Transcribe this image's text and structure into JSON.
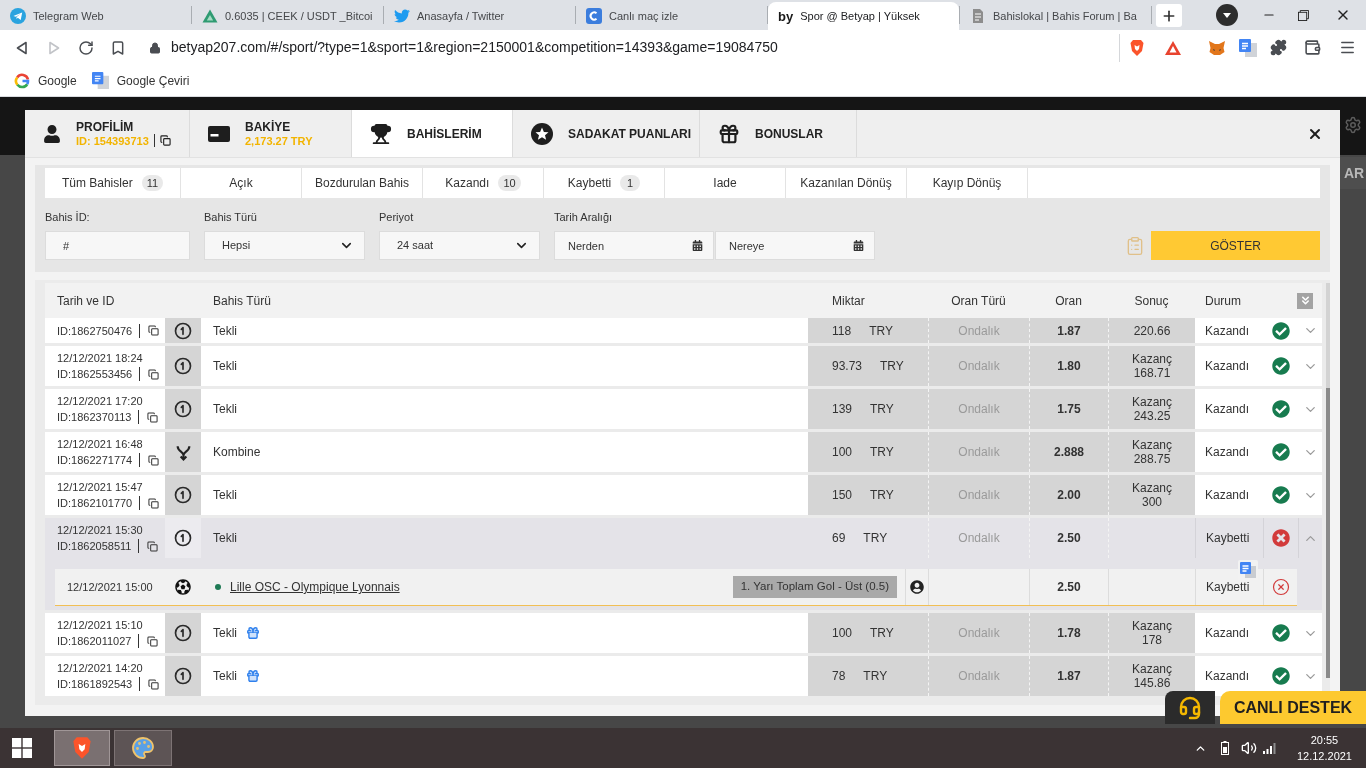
{
  "browser": {
    "tabs": [
      {
        "title": "Telegram Web",
        "kind": "telegram",
        "selected": false
      },
      {
        "title": "0.6035 | CEEK / USDT _Bitcoi",
        "kind": "ceek",
        "selected": false
      },
      {
        "title": "Anasayfa / Twitter",
        "kind": "twitter",
        "selected": false
      },
      {
        "title": "Canlı maç izle",
        "kind": "stream",
        "selected": false
      },
      {
        "title": "Spor @ Betyap | Yüksek",
        "kind": "betyap",
        "icon_text": "by",
        "selected": true
      },
      {
        "title": "Bahislokal | Bahis Forum | Ba",
        "kind": "forum",
        "selected": false
      }
    ],
    "forward_disabled": true,
    "url": "betyap207.com/#/sport/?type=1&sport=1&region=2150001&competition=14393&game=19084750",
    "bookmarks": [
      {
        "label": "Google",
        "kind": "google"
      },
      {
        "label": "Google Çeviri",
        "kind": "translate"
      }
    ]
  },
  "site_background": {
    "button_text": "AR"
  },
  "modal": {
    "tabs": [
      {
        "kind": "profile",
        "title": "PROFİLİM",
        "subtitle": "ID: 154393713",
        "selected": false
      },
      {
        "kind": "balance",
        "title": "BAKİYE",
        "subtitle": "2,173.27 TRY",
        "selected": false
      },
      {
        "kind": "bets",
        "title": "BAHİSLERİM",
        "selected": true
      },
      {
        "kind": "loyalty",
        "title": "SADAKAT PUANLARI",
        "selected": false
      },
      {
        "kind": "bonus",
        "title": "BONUSLAR",
        "selected": false
      }
    ],
    "filter_tabs": [
      {
        "label": "Tüm Bahisler",
        "count": "11"
      },
      {
        "label": "Açık"
      },
      {
        "label": "Bozdurulan Bahis"
      },
      {
        "label": "Kazandı",
        "count": "10"
      },
      {
        "label": "Kaybetti",
        "count": "1"
      },
      {
        "label": "Iade"
      },
      {
        "label": "Kazanılan Dönüş"
      },
      {
        "label": "Kayıp Dönüş"
      }
    ],
    "filters": [
      {
        "kind": "input",
        "label": "Bahis İD:",
        "placeholder": "#"
      },
      {
        "kind": "select",
        "label": "Bahis Türü",
        "value": "Hepsi"
      },
      {
        "kind": "select",
        "label": "Periyot",
        "value": "24 saat"
      },
      {
        "kind": "date_range",
        "label": "Tarih Aralığı",
        "from_placeholder": "Nerden",
        "to_placeholder": "Nereye"
      }
    ],
    "show_button": "GÖSTER",
    "table": {
      "columns": [
        "Tarih ve ID",
        "Bahis Türü",
        "Miktar",
        "Oran Türü",
        "Oran",
        "Sonuç",
        "Durum"
      ],
      "rows": [
        {
          "id": "ID:1862750476",
          "kind": "single",
          "type": "Tekli",
          "bonus": false,
          "amount": "118",
          "currency": "TRY",
          "odds_type": "Ondalık",
          "odds": "1.87",
          "result": {
            "value": "220.66"
          },
          "status": "Kazandı",
          "won": true,
          "expanded": false
        },
        {
          "date": "12/12/2021 18:24",
          "id": "ID:1862553456",
          "kind": "single",
          "type": "Tekli",
          "bonus": false,
          "amount": "93.73",
          "currency": "TRY",
          "odds_type": "Ondalık",
          "odds": "1.80",
          "result": {
            "label": "Kazanç",
            "value": "168.71"
          },
          "status": "Kazandı",
          "won": true,
          "expanded": false
        },
        {
          "date": "12/12/2021 17:20",
          "id": "ID:1862370113",
          "kind": "single",
          "type": "Tekli",
          "bonus": false,
          "amount": "139",
          "currency": "TRY",
          "odds_type": "Ondalık",
          "odds": "1.75",
          "result": {
            "label": "Kazanç",
            "value": "243.25"
          },
          "status": "Kazandı",
          "won": true,
          "expanded": false
        },
        {
          "date": "12/12/2021 16:48",
          "id": "ID:1862271774",
          "kind": "combo",
          "type": "Kombine",
          "bonus": false,
          "amount": "100",
          "currency": "TRY",
          "odds_type": "Ondalık",
          "odds": "2.888",
          "result": {
            "label": "Kazanç",
            "value": "288.75"
          },
          "status": "Kazandı",
          "won": true,
          "expanded": false
        },
        {
          "date": "12/12/2021 15:47",
          "id": "ID:1862101770",
          "kind": "single",
          "type": "Tekli",
          "bonus": false,
          "amount": "150",
          "currency": "TRY",
          "odds_type": "Ondalık",
          "odds": "2.00",
          "result": {
            "label": "Kazanç",
            "value": "300"
          },
          "status": "Kazandı",
          "won": true,
          "expanded": false
        },
        {
          "date": "12/12/2021 15:30",
          "id": "ID:1862058511",
          "kind": "single",
          "type": "Tekli",
          "bonus": false,
          "amount": "69",
          "currency": "TRY",
          "odds_type": "Ondalık",
          "odds": "2.50",
          "status": "Kaybetti",
          "won": false,
          "expanded": true,
          "selections": [
            {
              "date": "12/12/2021 15:00",
              "match": "Lille OSC - Olympique Lyonnais",
              "market": "1. Yarı Toplam Gol - Üst (0.5)",
              "odds": "2.50",
              "status": "Kaybetti",
              "won": false
            }
          ]
        },
        {
          "date": "12/12/2021 15:10",
          "id": "ID:1862011027",
          "kind": "single",
          "type": "Tekli",
          "bonus": true,
          "amount": "100",
          "currency": "TRY",
          "odds_type": "Ondalık",
          "odds": "1.78",
          "result": {
            "label": "Kazanç",
            "value": "178"
          },
          "status": "Kazandı",
          "won": true,
          "expanded": false
        },
        {
          "date": "12/12/2021 14:20",
          "id": "ID:1861892543",
          "kind": "single",
          "type": "Tekli",
          "bonus": true,
          "amount": "78",
          "currency": "TRY",
          "odds_type": "Ondalık",
          "odds": "1.87",
          "result": {
            "label": "Kazanç",
            "value": "145.86"
          },
          "status": "Kazandı",
          "won": true,
          "expanded": false
        }
      ]
    }
  },
  "live_support": {
    "label": "CANLI DESTEK"
  },
  "taskbar": {
    "time": "20:55",
    "date": "12.12.2021"
  }
}
